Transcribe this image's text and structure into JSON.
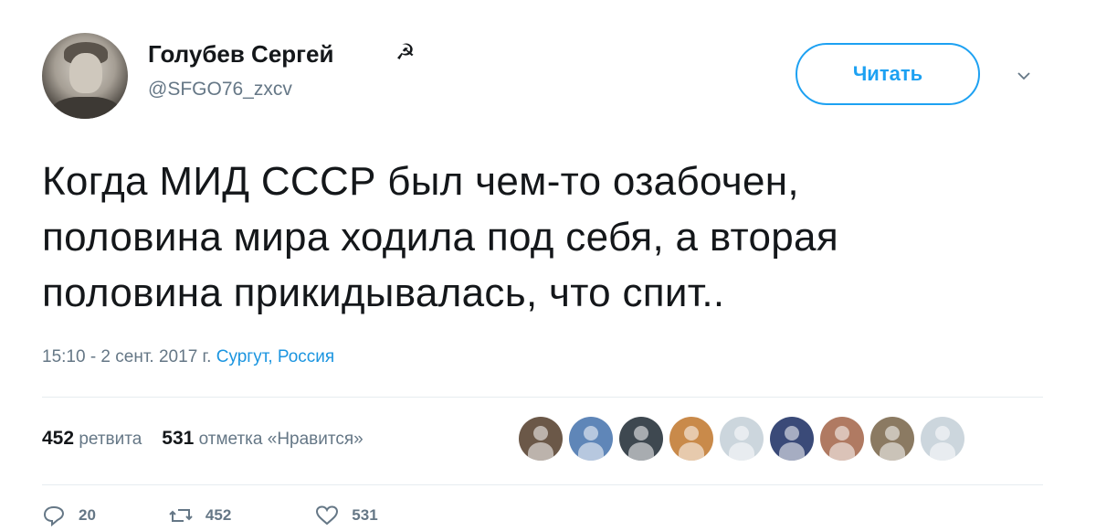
{
  "profile": {
    "display_name": "Голубев Сергей",
    "name_icon": "hammer-and-sickle-icon",
    "name_icon_glyph": "☭",
    "handle": "@SFGO76_zxcv"
  },
  "follow_button": {
    "label": "Читать"
  },
  "tweet": {
    "lines": [
      "Когда МИД СССР был чем-то озабочен,",
      "половина мира ходила под себя, а вторая",
      "половина прикидывалась, что спит.."
    ]
  },
  "meta": {
    "time_date": "15:10 - 2 сент. 2017 г.",
    "location": "Сургут, Россия"
  },
  "stats": {
    "retweets_count": "452",
    "retweets_label": "ретвита",
    "likes_count": "531",
    "likes_label": "отметка «Нравится»"
  },
  "liker_avatars": [
    {
      "color": "#6b5848"
    },
    {
      "color": "#5f86b8"
    },
    {
      "color": "#3e4850"
    },
    {
      "color": "#c98a4a"
    },
    {
      "color": "#ccd6dd"
    },
    {
      "color": "#3a4a78"
    },
    {
      "color": "#b07a62"
    },
    {
      "color": "#8b7a62"
    },
    {
      "color": "#ccd6dd"
    }
  ],
  "actions": {
    "reply_count": "20",
    "retweet_count": "452",
    "like_count": "531"
  },
  "colors": {
    "accent": "#1da1f2",
    "secondary_text": "#657786",
    "primary_text": "#14171a"
  }
}
